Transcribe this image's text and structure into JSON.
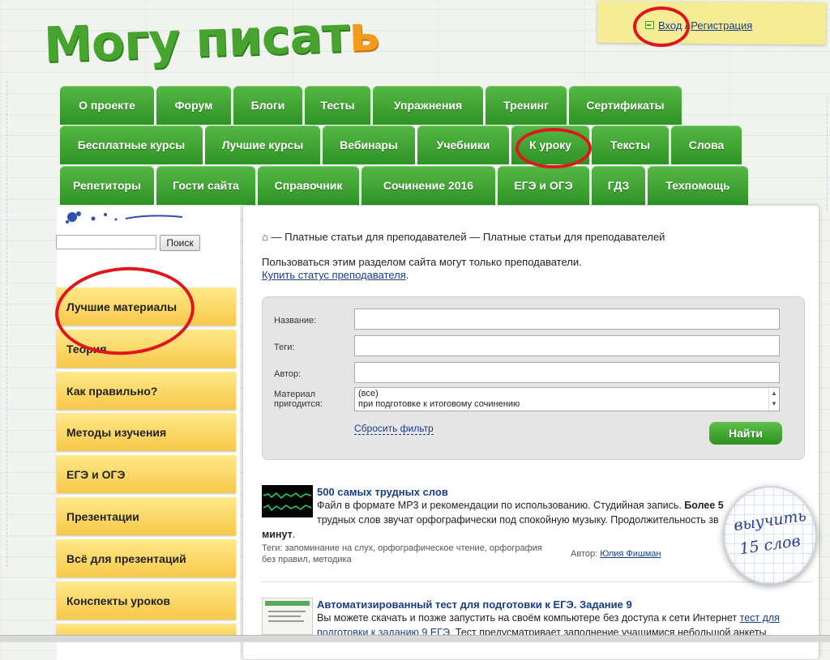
{
  "logo": {
    "main": "Могу писат",
    "last_letter": "ь"
  },
  "auth": {
    "login": "Вход",
    "separator": "/",
    "register": "Регистрация"
  },
  "menu": {
    "row1": [
      "О проекте",
      "Форум",
      "Блоги",
      "Тесты",
      "Упражнения",
      "Тренинг",
      "Сертификаты"
    ],
    "row2": [
      "Бесплатные курсы",
      "Лучшие курсы",
      "Вебинары",
      "Учебники",
      "К уроку",
      "Тексты",
      "Слова"
    ],
    "row3": [
      "Репетиторы",
      "Гости сайта",
      "Справочник",
      "Сочинение 2016",
      "ЕГЭ и ОГЭ",
      "ГДЗ",
      "Техпомощь"
    ]
  },
  "search": {
    "button": "Поиск"
  },
  "sidebar": {
    "items": [
      "Лучшие материалы",
      "Теория",
      "Как правильно?",
      "Методы изучения",
      "ЕГЭ и ОГЭ",
      "Презентации",
      "Всё для презентаций",
      "Конспекты уроков"
    ]
  },
  "breadcrumb": {
    "home_icon": "⌂",
    "text": "— Платные статьи для преподавателей — Платные статьи для преподавателей"
  },
  "notice": {
    "text": "Пользоваться этим разделом сайта могут только преподаватели.",
    "link": "Купить статус преподавателя",
    "link_suffix": "."
  },
  "filter": {
    "name_label": "Название:",
    "tags_label": "Теги:",
    "author_label": "Автор:",
    "material_label_1": "Материал",
    "material_label_2": "пригодится:",
    "options": [
      "(все)",
      "при подготовке к итоговому сочинению"
    ],
    "reset": "Сбросить фильтр",
    "submit": "Найти"
  },
  "items": [
    {
      "title": "500 самых трудных слов",
      "text_1": "Файл в формате MP3 и рекомендации по использованию. Студийная запись.",
      "text_bold": "Более 5",
      "text_2": "трудных слов звучат орфографически под спокойную музыку. Продолжительность зв",
      "text_3": "минут",
      "text_3_suffix": ".",
      "tags_1": "Теги: запоминание на слух, орфографическое чтение, орфография",
      "tags_2": "без правил, методика",
      "author_label": "Автор:",
      "author": "Юлия Фишман"
    },
    {
      "title": "Автоматизированный тест для подготовки к ЕГЭ. Задание 9",
      "text_1": "Вы можете скачать и позже запустить на своём компьютере без доступа к сети Интернет",
      "link_1": "тест для",
      "link_2": "подготовки к заданию 9 ЕГЭ",
      "text_2": ". Тест предусматривает заполнение учащимися небольшой анкеты"
    }
  ],
  "badge": {
    "line1": "выучить",
    "line2": "15 слов"
  },
  "colors": {
    "menu_green": "#3fa130",
    "sidebar_yellow": "#f7c84a",
    "link_blue": "#1a3d8a",
    "annotation_red": "#e0161c"
  },
  "icons": [
    "enter-icon",
    "home-icon",
    "scroll-arrows-icon"
  ]
}
